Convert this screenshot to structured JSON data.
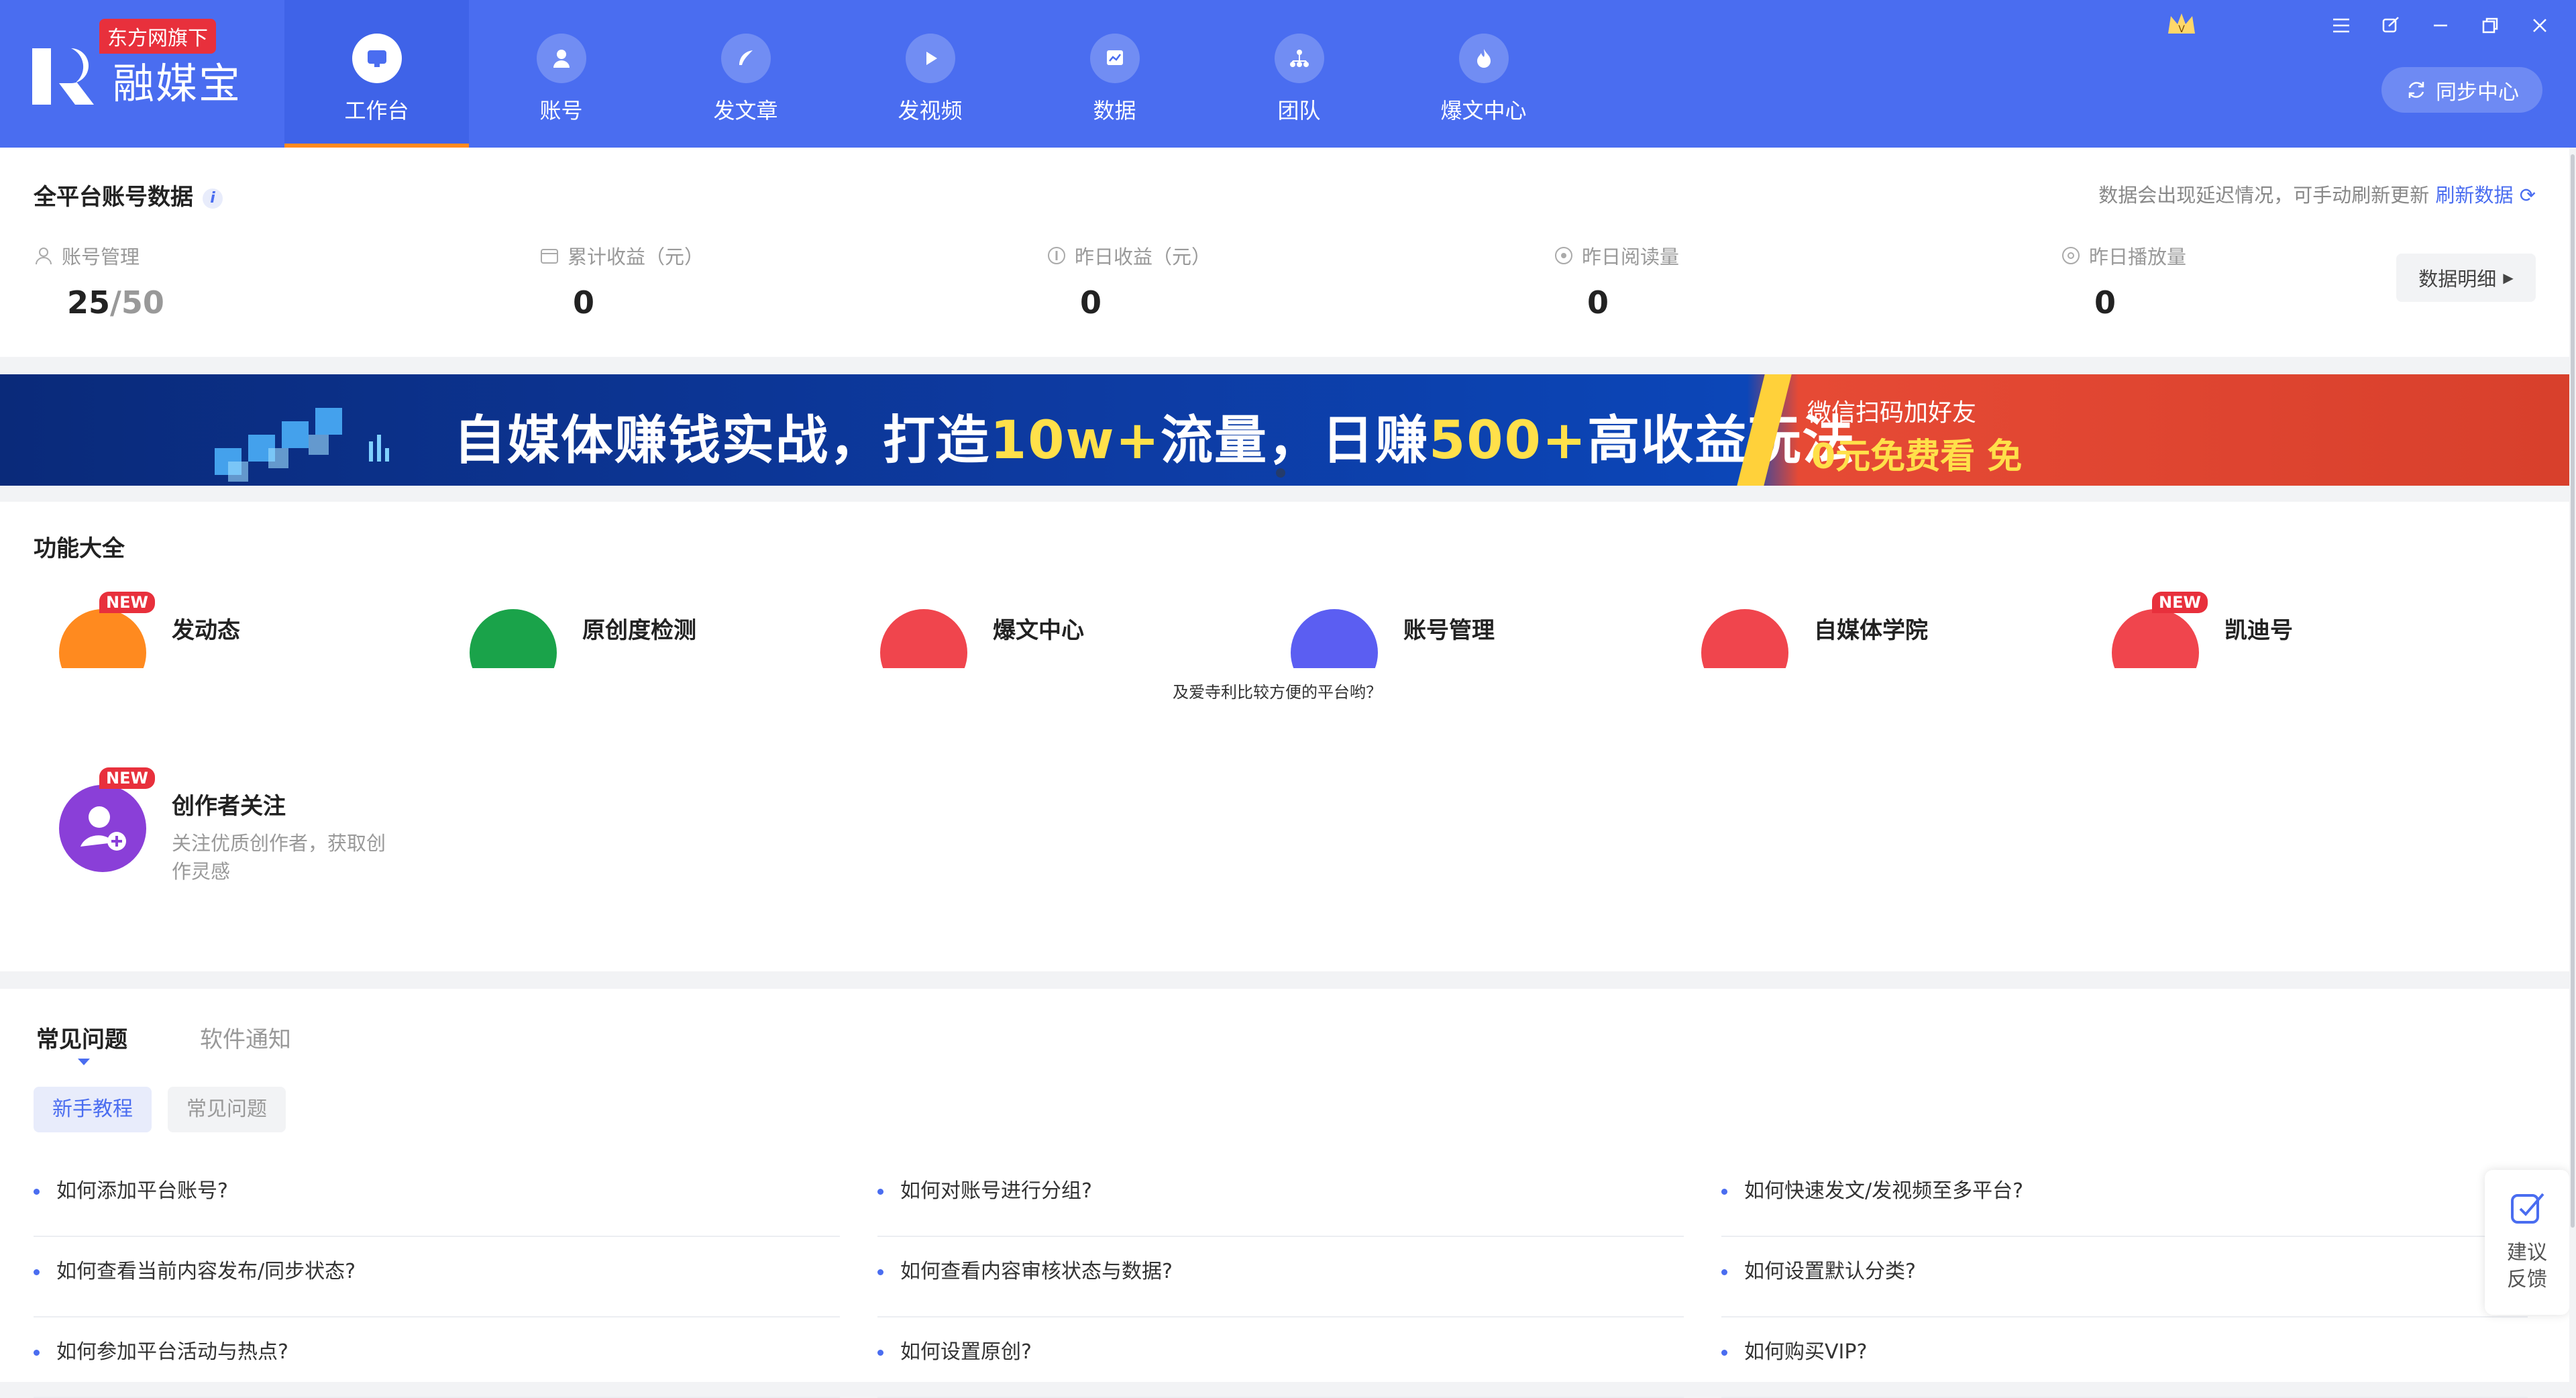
{
  "app": {
    "name": "融媒宝",
    "badge": "东方网旗下"
  },
  "nav": [
    {
      "label": "工作台",
      "icon": "monitor-icon",
      "active": true
    },
    {
      "label": "账号",
      "icon": "user-icon"
    },
    {
      "label": "发文章",
      "icon": "feather-icon"
    },
    {
      "label": "发视频",
      "icon": "play-icon"
    },
    {
      "label": "数据",
      "icon": "chart-icon"
    },
    {
      "label": "团队",
      "icon": "team-icon"
    },
    {
      "label": "爆文中心",
      "icon": "flame-icon"
    }
  ],
  "header": {
    "sync_label": "同步中心"
  },
  "overview": {
    "title": "全平台账号数据",
    "hint": "数据会出现延迟情况，可手动刷新更新",
    "refresh": "刷新数据",
    "detail_button": "数据明细",
    "stats": [
      {
        "label": "账号管理",
        "value": "25",
        "total": "/50",
        "icon": "user-icon"
      },
      {
        "label": "累计收益（元）",
        "value": "0",
        "icon": "wallet-icon"
      },
      {
        "label": "昨日收益（元）",
        "value": "0",
        "icon": "coin-icon"
      },
      {
        "label": "昨日阅读量",
        "value": "0",
        "icon": "eye-icon"
      },
      {
        "label": "昨日播放量",
        "value": "0",
        "icon": "play-circle-icon"
      }
    ]
  },
  "banner": {
    "text_a": "自媒体赚钱实战，打造",
    "text_b": "10w+",
    "text_c": "流量，日赚",
    "text_d": "500+",
    "text_e": "高收益玩法",
    "right_1": "微信扫码加好友 ",
    "right_2": "0元免费看 免"
  },
  "features": {
    "title": "功能大全",
    "toast": "及爱寺利比较方便的平台哟？",
    "items": [
      {
        "name": "发动态",
        "new": true,
        "color": "#ff8a1f",
        "icon": "send-icon"
      },
      {
        "name": "原创度检测",
        "new": false,
        "color": "#1aa34a",
        "icon": "check-icon"
      },
      {
        "name": "爆文中心",
        "new": false,
        "color": "#f0454d",
        "icon": "flame-icon"
      },
      {
        "name": "账号管理",
        "new": false,
        "color": "#5b5ef2",
        "icon": "user-icon"
      },
      {
        "name": "自媒体学院",
        "new": false,
        "color": "#f0454d",
        "icon": "academy-icon"
      },
      {
        "name": "凯迪号",
        "new": true,
        "color": "#f0454d",
        "icon": "kaidi-icon"
      },
      {
        "name": "创作者关注",
        "new": true,
        "color": "#8a3fd8",
        "icon": "add-user-icon",
        "desc": "关注优质创作者，获取创作灵感"
      }
    ]
  },
  "help": {
    "tabs": [
      "常见问题",
      "软件通知"
    ],
    "pills": [
      "新手教程",
      "常见问题"
    ],
    "questions": [
      "如何添加平台账号?",
      "如何对账号进行分组?",
      "如何快速发文/发视频至多平台?",
      "如何查看当前内容发布/同步状态?",
      "如何查看内容审核状态与数据?",
      "如何设置默认分类?",
      "如何参加平台活动与热点?",
      "如何设置原创?",
      "如何购买VIP?"
    ]
  },
  "feedback": {
    "line1": "建议",
    "line2": "反馈"
  }
}
